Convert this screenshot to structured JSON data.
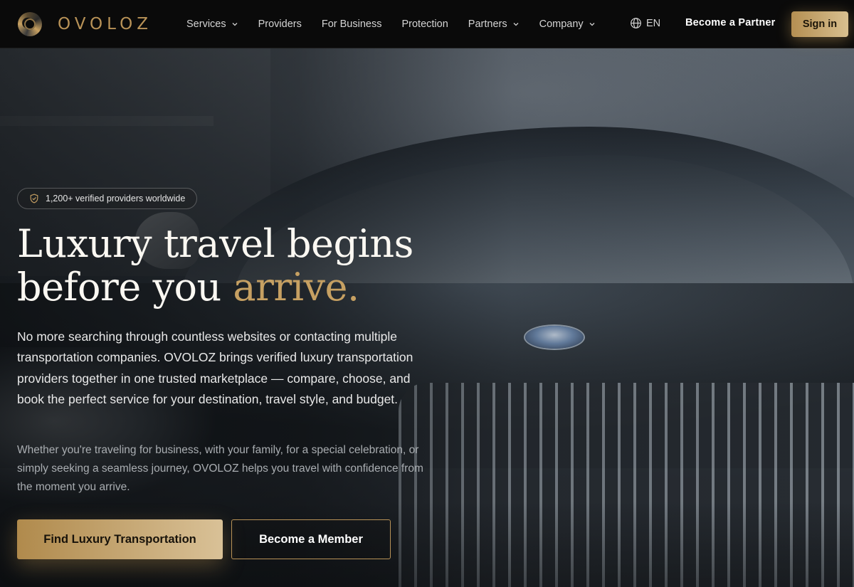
{
  "brand": {
    "name": "OVOLOZ"
  },
  "nav": {
    "items": [
      {
        "label": "Services",
        "has_dropdown": true
      },
      {
        "label": "Providers",
        "has_dropdown": false
      },
      {
        "label": "For Business",
        "has_dropdown": false
      },
      {
        "label": "Protection",
        "has_dropdown": false
      },
      {
        "label": "Partners",
        "has_dropdown": true
      },
      {
        "label": "Company",
        "has_dropdown": true
      }
    ],
    "language": "EN",
    "partner_link": "Become a Partner",
    "signin_label": "Sign in"
  },
  "hero": {
    "pill_text": "1,200+ verified providers worldwide",
    "headline_line1": "Luxury travel begins",
    "headline_line2_start": "before you ",
    "headline_line2_accent": "arrive.",
    "lead": "No more searching through countless websites or contacting multiple transportation companies. OVOLOZ brings verified luxury transportation providers together in one trusted marketplace — compare, choose, and book the perfect service for your destination, travel style, and budget.",
    "sub": "Whether you're traveling for business, with your family, for a special celebration, or simply seeking a seamless journey, OVOLOZ helps you travel with confidence from the moment you arrive.",
    "primary_cta": "Find Luxury Transportation",
    "secondary_cta": "Become a Member"
  },
  "colors": {
    "accent_gold": "#c6a062",
    "nav_bg": "#0a0a0a"
  },
  "icons": {
    "shield": "shield-check-icon",
    "globe": "globe-icon",
    "chevron": "chevron-down-icon"
  }
}
